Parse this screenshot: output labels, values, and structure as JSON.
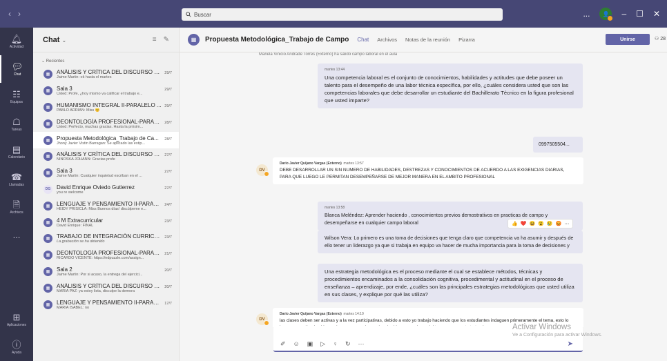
{
  "topbar": {
    "back_icon": "chevron-left",
    "forward_icon": "chevron-right",
    "search_placeholder": "Buscar",
    "more": "...",
    "minimize": "–",
    "restore": "☐",
    "close": "✕"
  },
  "rail": {
    "items": [
      {
        "label": "Actividad",
        "icon": "bell-icon"
      },
      {
        "label": "Chat",
        "icon": "chat-icon"
      },
      {
        "label": "Equipos",
        "icon": "teams-icon"
      },
      {
        "label": "Tareas",
        "icon": "tasks-icon"
      },
      {
        "label": "Calendario",
        "icon": "calendar-icon"
      },
      {
        "label": "Llamadas",
        "icon": "phone-icon"
      },
      {
        "label": "Archivos",
        "icon": "file-icon"
      },
      {
        "label": "...",
        "icon": "more-icon"
      }
    ],
    "bottom": [
      {
        "label": "Aplicaciones",
        "icon": "apps-icon"
      },
      {
        "label": "Ayuda",
        "icon": "help-icon"
      }
    ]
  },
  "chatlist": {
    "title": "Chat",
    "section": "Recientes",
    "items": [
      {
        "name": "ANÁLISIS Y CRÍTICA DEL DISCURSO PE...",
        "date": "29/7",
        "preview": "Jaime Martin: ok hasta el martes",
        "type": "group"
      },
      {
        "name": "Sala 3",
        "date": "29/7",
        "preview": "Usted: Profe, ¿hoy mismo va calificar el trabajo e...",
        "type": "group"
      },
      {
        "name": "HUMANISMO INTEGRAL II-PARALELO ...",
        "date": "29/7",
        "preview": "PABLO ADRIAN: Miss 😊",
        "type": "group"
      },
      {
        "name": "DEONTOLOGÍA PROFESIONAL-PARALE...",
        "date": "28/7",
        "preview": "Usted: Perfecto, muchas gracias. Hasta la próxim...",
        "type": "group"
      },
      {
        "name": "Propuesta Metodológica_Trabajo de Ca...",
        "date": "28/7",
        "preview": "Jhony Javier Vistin Barragan: Se aplicado las estip...",
        "type": "group",
        "selected": true
      },
      {
        "name": "ANÁLISIS Y CRÍTICA DEL DISCURSO PE...",
        "date": "27/7",
        "preview": "NINOSKA JOHANN: Gracias profe",
        "type": "group"
      },
      {
        "name": "Sala 3",
        "date": "27/7",
        "preview": "Jaime Martin: Cualquier inquietud escriban en el ...",
        "type": "group"
      },
      {
        "name": "David Enrique Oviedo Gutierrez",
        "date": "27/7",
        "preview": "you re welcome",
        "type": "person",
        "initials": "DG"
      },
      {
        "name": "LENGUAJE Y PENSAMIENTO II-PARALEL...",
        "date": "24/7",
        "preview": "HEIDY PRISICLA: Miss Buenos días! discúlpeme e...",
        "type": "group"
      },
      {
        "name": "4 M Extracurricular",
        "date": "23/7",
        "preview": "David Enrique: FINAL",
        "type": "group"
      },
      {
        "name": "TRABAJO DE INTEGRACIÓN CURRICUL...",
        "date": "23/7",
        "preview": "La grabación se ha detenido",
        "type": "group",
        "italic": true
      },
      {
        "name": "DEONTOLOGÍA PROFESIONAL-PARALE...",
        "date": "21/7",
        "preview": "RICARDO VICENTE: https://edpuzzle.com/assign...",
        "type": "group"
      },
      {
        "name": "Sala 2",
        "date": "20/7",
        "preview": "Jaime Martin: Por si acaso, la entrega del ejercici...",
        "type": "group"
      },
      {
        "name": "ANÁLISIS Y CRÍTICA DEL DISCURSO PE...",
        "date": "20/7",
        "preview": "MARIA PAZ: ya estoy lista, disculpe la demora",
        "type": "group"
      },
      {
        "name": "LENGUAJE Y PENSAMIENTO II-PARALEL...",
        "date": "17/7",
        "preview": "MARIA ISABEL: no",
        "type": "group"
      }
    ]
  },
  "main": {
    "title": "Propuesta Metodológica_Trabajo de Campo",
    "tabs": [
      {
        "label": "Chat",
        "active": true
      },
      {
        "label": "Archivos"
      },
      {
        "label": "Notas de la reunión"
      },
      {
        "label": "Pizarra"
      }
    ],
    "join_label": "Unirse",
    "people_count": "28",
    "cut_text": "Mariela Vinicio Andrade Torres (Externo) ha salido campo laboral en el aula",
    "bubble1": {
      "meta": "martes 13:44",
      "body": "Una competencia laboral es el conjunto de conocimientos, habilidades y actitudes que debe poseer un talento para el desempeño de una labor técnica específica, por ello, ¿cuáles considera usted que son las competencias laborales que debe desarrollar un estudiante del Bachillerato Técnico en la figura profesional que usted imparte?"
    },
    "phone_bubble": "0997505504...",
    "msg1": {
      "initials": "DV",
      "sender": "Dario Javier Quijano Vargas (Externo)",
      "time": "martes 13:57",
      "body": "DEBE DESARROLLAR UN SIN NUMERO DE HABILIDADES, DESTREZAS Y CONOCIMIENTOS DE ACUERDO A LAS EXIGENCIAS DIARIAS, PARA QUE LUEGO LE PERMITAN DESEMPEÑARSE DE MEJOR MANERA EN EL AMBITO PROFESIONAL"
    },
    "bubble2": {
      "meta": "martes 13:58",
      "body": "Blanca Meléndez: Aprender haciendo , conocimientos previos  demostrativos en practicas de campo y desempeñarse en cualquier campo laboral"
    },
    "reactions": [
      "👍",
      "❤️",
      "😆",
      "😮",
      "😢",
      "😡",
      "···"
    ],
    "bubble3": {
      "body": "Wilson Vera: Lo primero es una toma de decisiones que tenga claro que competencia va  ha  asumir y después de ello tener un liderazgo ya que si trabaja en equipo va hacer de mucha importancia para la toma de decisiones y"
    },
    "bubble4": {
      "body": "Una estrategia metodológica es el proceso mediante el cual se establece métodos, técnicas y procedimientos encaminados a la consolidación cognitiva, procedimental y actitudinal en el proceso de enseñanza – aprendizaje, por ende, ¿cuáles son las principales estrategias metodológicas que usted utiliza en sus clases, y explique por qué las utiliza?"
    },
    "msg2": {
      "initials": "DV",
      "sender": "Dario Javier Quijano Vargas (Externo)",
      "time": "martes 14:10",
      "body": "las clases deben ser activas y a la vez participativas, debido a esto yo trabajo haciendo que los estudiantes indaguen primeramente el tema, esto lo hago compartiendo videos e imagenes que le puedan dar ideas mas claras del tema que se esta tratando"
    },
    "compose_tools": [
      "format-icon",
      "emoji-icon",
      "gif-icon",
      "sticker-icon",
      "meet-icon",
      "loop-icon",
      "more-icon"
    ],
    "watermark": {
      "line1": "Activar Windows",
      "line2": "Ve a Configuración para activar Windows."
    }
  }
}
